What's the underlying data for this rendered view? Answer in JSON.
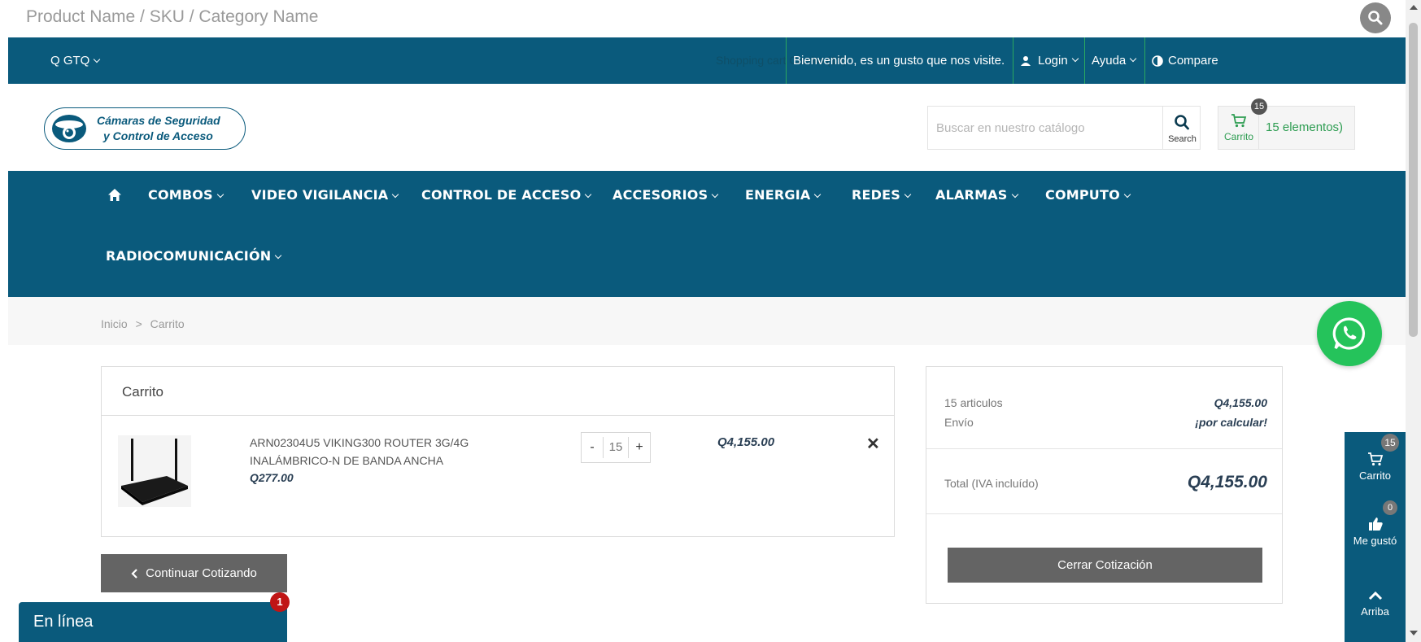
{
  "top_search": {
    "placeholder": "Product Name / SKU / Category Name"
  },
  "topbar": {
    "currency": "Q GTQ",
    "shopping_note": "Shopping cart Carrito (15)",
    "welcome": "Bienvenido, es un gusto que nos visite.",
    "login": "Login",
    "help": "Ayuda",
    "compare": "Compare"
  },
  "logo": {
    "line1": "Cámaras de Seguridad",
    "line2": "y Control de Acceso"
  },
  "catalog_search": {
    "placeholder": "Buscar en nuestro catálogo",
    "button_label": "Search"
  },
  "header_cart": {
    "label": "Carrito",
    "count": "15",
    "items": "15 elementos)"
  },
  "nav": {
    "items": [
      "COMBOS",
      "VIDEO VIGILANCIA",
      "CONTROL DE ACCESO",
      "ACCESORIOS",
      "ENERGIA",
      "REDES",
      "ALARMAS",
      "COMPUTO",
      "RADIOCOMUNICACIÓN"
    ]
  },
  "breadcrumb": {
    "home": "Inicio",
    "sep": ">",
    "current": "Carrito"
  },
  "cart": {
    "title": "Carrito",
    "item": {
      "name": "ARN02304U5 VIKING300 ROUTER 3G/4G INALÁMBRICO-N DE BANDA ANCHA",
      "unit_price": "Q277.00",
      "quantity": "15",
      "minus": "-",
      "plus": "+",
      "total": "Q4,155.00",
      "remove": "✕"
    },
    "continue_label": "Continuar Cotizando"
  },
  "summary": {
    "articles_label": "15 articulos",
    "articles_value": "Q4,155.00",
    "shipping_label": "Envío",
    "shipping_value": "¡por calcular!",
    "total_label": "Total (IVA incluído)",
    "total_value": "Q4,155.00",
    "checkout_label": "Cerrar Cotización"
  },
  "sidebar": {
    "cart_label": "Carrito",
    "cart_count": "15",
    "like_label": "Me gustó",
    "like_count": "0",
    "top_label": "Arriba"
  },
  "chat": {
    "label": "En línea",
    "badge": "1"
  },
  "colors": {
    "primary": "#0a5a7c",
    "accent_green": "#2e9d52",
    "button_gray": "#646464",
    "whatsapp": "#25c35b"
  }
}
